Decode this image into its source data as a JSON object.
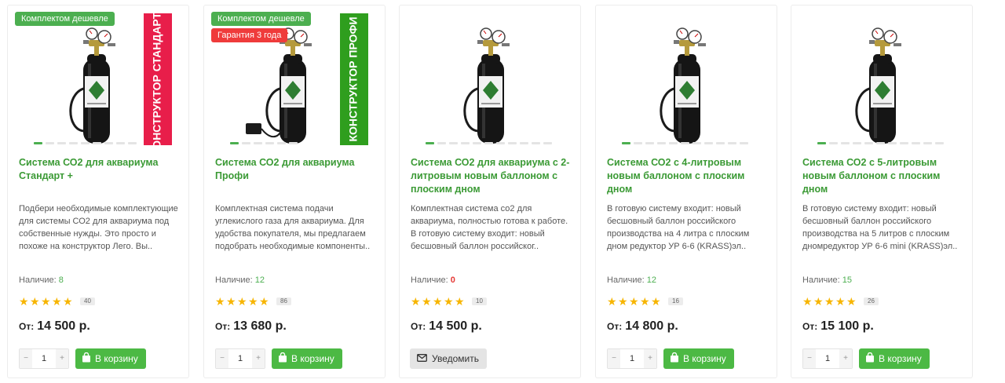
{
  "products": [
    {
      "badges": [
        {
          "text": "Комплектом дешевле",
          "color": "green"
        }
      ],
      "title": "Система СО2 для аквариума Стандарт +",
      "description": "Подбери необходимые комплектующие для системы СО2 для аквариума под собственные нужды. Это просто и похоже на конструктор Лего. Вы..",
      "stock_label": "Наличие:",
      "stock": "8",
      "reviews": "40",
      "price_prefix": "От:",
      "price": "14 500 р.",
      "qty": "1",
      "button": "В корзину",
      "banner_text": "КОНСТРУКТОР СТАНДАРТ +",
      "banner_color": "#e81e4a",
      "slides": 9,
      "action": "cart"
    },
    {
      "badges": [
        {
          "text": "Комплектом дешевле",
          "color": "green"
        },
        {
          "text": "Гарантия 3 года",
          "color": "red"
        }
      ],
      "title": "Система СО2 для аквариума Профи",
      "description": "Комплектная система подачи углекислого газа для аквариума. Для удобства покупателя, мы предлагаем подобрать необходимые компоненты..",
      "stock_label": "Наличие:",
      "stock": "12",
      "reviews": "86",
      "price_prefix": "От:",
      "price": "13 680 р.",
      "qty": "1",
      "button": "В корзину",
      "banner_text": "КОНСТРУКТОР ПРОФИ",
      "banner_color": "#2f9e1e",
      "slides": 6,
      "action": "cart"
    },
    {
      "badges": [],
      "title": "Система СО2 для аквариума с 2-литровым новым баллоном с плоским дном",
      "description": "Комплектная система со2 для аквариума, полностью готова к работе. В готовую систему входит: новый бесшовный баллон российског..",
      "stock_label": "Наличие:",
      "stock": "0",
      "reviews": "10",
      "price_prefix": "От:",
      "price": "14 500 р.",
      "qty": "1",
      "button": "Уведомить",
      "banner_text": "",
      "banner_color": "",
      "slides": 11,
      "action": "notify"
    },
    {
      "badges": [],
      "title": "Система СО2 с 4-литровым новым баллоном с плоским дном",
      "description": "В готовую систему входит: новый бесшовный баллон российского производства на 4 литра с плоским дном редуктор УР 6-6 (KRASS)эл..",
      "stock_label": "Наличие:",
      "stock": "12",
      "reviews": "16",
      "price_prefix": "От:",
      "price": "14 800 р.",
      "qty": "1",
      "button": "В корзину",
      "banner_text": "",
      "banner_color": "",
      "slides": 11,
      "action": "cart"
    },
    {
      "badges": [],
      "title": "Система СО2 с 5-литровым новым баллоном с плоским дном",
      "description": "В готовую систему входит: новый бесшовный баллон российского производства на 5 литров с плоским дномредуктор УР 6-6 mini (KRASS)эл..",
      "stock_label": "Наличие:",
      "stock": "15",
      "reviews": "26",
      "price_prefix": "От:",
      "price": "15 100 р.",
      "qty": "1",
      "button": "В корзину",
      "banner_text": "",
      "banner_color": "",
      "slides": 11,
      "action": "cart"
    }
  ],
  "icons": {
    "star": "star-icon",
    "cart": "shopping-bag-icon",
    "notify": "envelope-icon",
    "minus": "minus-icon",
    "plus": "plus-icon"
  },
  "colors": {
    "accent": "#4caf50",
    "title": "#3b9a35",
    "star": "#f7b500",
    "out_of_stock": "#e53935",
    "cart_button": "#4cb944",
    "badge_red": "#ef3b3b"
  }
}
